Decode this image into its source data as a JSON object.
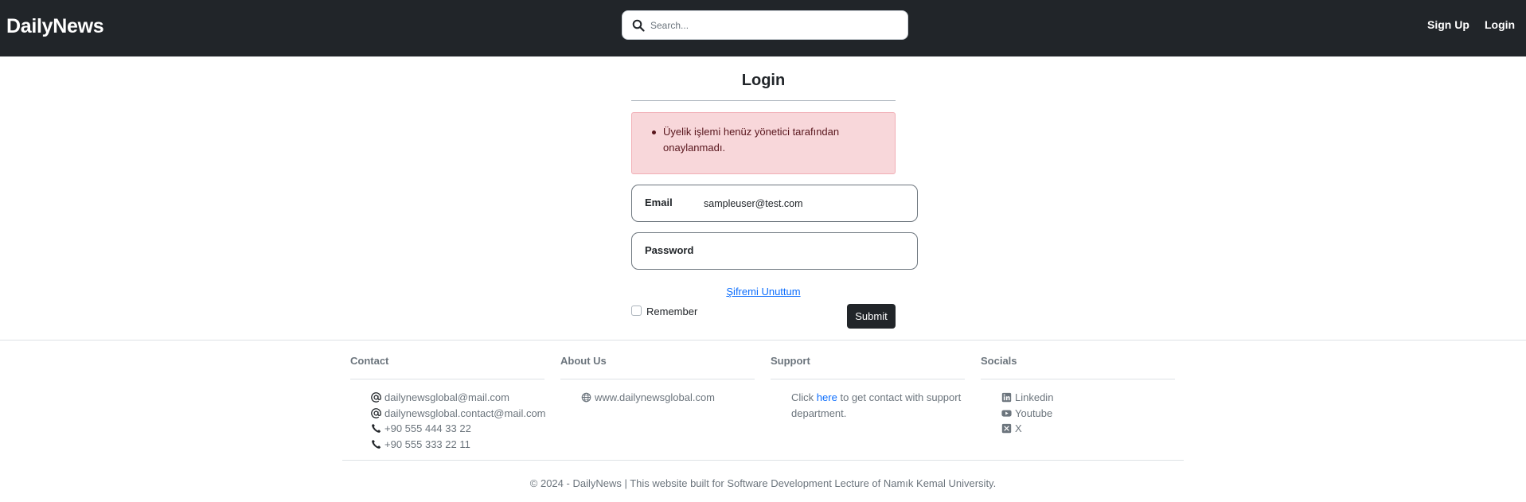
{
  "navbar": {
    "brand": "DailyNews",
    "search_placeholder": "Search...",
    "signup_label": "Sign Up",
    "login_label": "Login"
  },
  "login": {
    "title": "Login",
    "alert_message": "Üyelik işlemi henüz yönetici tarafından onaylanmadı.",
    "email_label": "Email",
    "email_value": "sampleuser@test.com",
    "password_label": "Password",
    "password_value": "",
    "forgot_label": "Şifremi Unuttum",
    "remember_label": "Remember",
    "remember_checked": false,
    "submit_label": "Submit"
  },
  "footer": {
    "contact": {
      "heading": "Contact",
      "items": [
        {
          "icon": "at-icon",
          "text": "dailynewsglobal@mail.com"
        },
        {
          "icon": "at-icon",
          "text": "dailynewsglobal.contact@mail.com"
        },
        {
          "icon": "phone-icon",
          "text": "+90 555 444 33 22"
        },
        {
          "icon": "phone-icon",
          "text": "+90 555 333 22 11"
        }
      ]
    },
    "about": {
      "heading": "About Us",
      "items": [
        {
          "icon": "globe-icon",
          "text": "www.dailynewsglobal.com"
        }
      ]
    },
    "support": {
      "heading": "Support",
      "text_before": "Click",
      "link_text": "here",
      "text_after": "to get contact with support department."
    },
    "socials": {
      "heading": "Socials",
      "items": [
        {
          "icon": "linkedin-icon",
          "text": "Linkedin"
        },
        {
          "icon": "youtube-icon",
          "text": "Youtube"
        },
        {
          "icon": "x-icon",
          "text": "X"
        }
      ]
    },
    "copyright": "© 2024 - DailyNews | This website built for Software Development Lecture of Namık Kemal University."
  },
  "colors": {
    "navbar_bg": "#212529",
    "alert_bg": "#f8d7da",
    "alert_text": "#58151c",
    "link": "#0d6efd",
    "muted": "#6c757d"
  }
}
